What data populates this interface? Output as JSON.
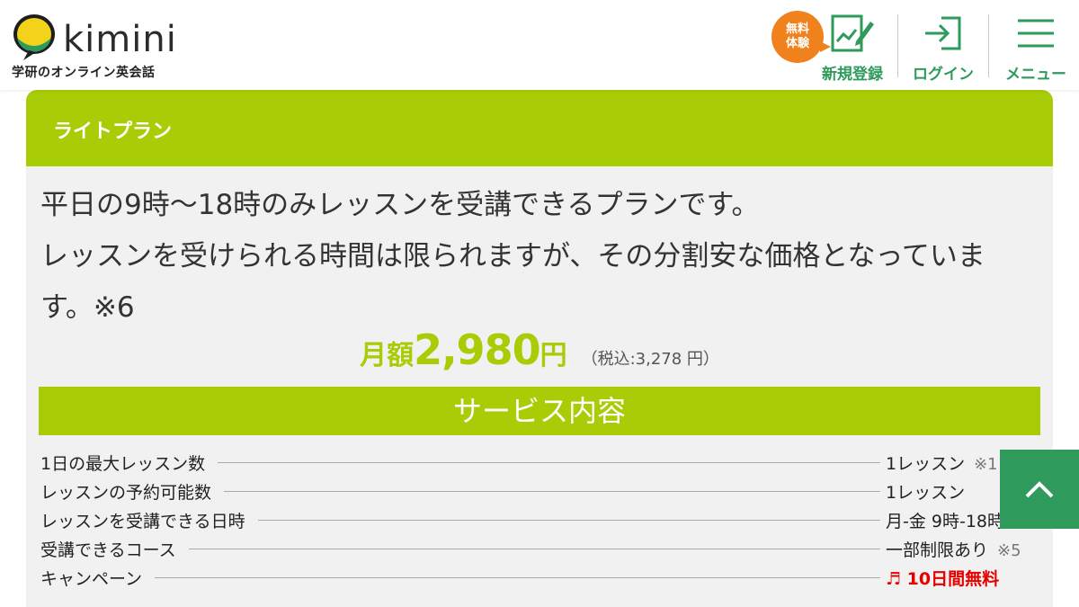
{
  "header": {
    "brand": "kimini",
    "brand_sub": "学研のオンライン英会話",
    "trial_badge": "無料\n体験",
    "nav": {
      "signup": "新規登録",
      "login": "ログイン",
      "menu": "メニュー"
    }
  },
  "plan": {
    "title": "ライトプラン",
    "description": "平日の9時〜18時のみレッスンを受講できるプランです。\nレッスンを受けられる時間は限られますが、その分割安な価格となっています。※6",
    "price_prefix": "月額",
    "price_amount": "2,980",
    "price_unit": "円",
    "price_tax": "（税込:3,278 円）"
  },
  "services": {
    "heading": "サービス内容",
    "rows": [
      {
        "label": "1日の最大レッスン数",
        "value": "1レッスン",
        "note": "※1"
      },
      {
        "label": "レッスンの予約可能数",
        "value": "1レッスン",
        "note": ""
      },
      {
        "label": "レッスンを受講できる日時",
        "value": "月-金 9時-18時",
        "note": ""
      },
      {
        "label": "受講できるコース",
        "value": "一部制限あり",
        "note": "※5"
      },
      {
        "label": "キャンペーン",
        "value": "♬ 10日間無料",
        "note": ""
      }
    ]
  },
  "colors": {
    "accent": "#a8cc05",
    "brand_green": "#2e9a5c",
    "badge_orange": "#f0821e",
    "campaign_red": "#e60000",
    "card_bg": "#f1f1f1"
  }
}
